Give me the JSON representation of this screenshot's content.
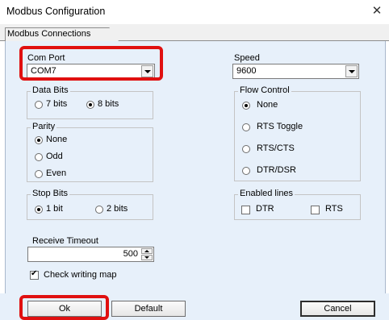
{
  "window": {
    "title": "Modbus Configuration",
    "close_glyph": "✕"
  },
  "tab": {
    "label": "Modbus Connections"
  },
  "com_port": {
    "label": "Com Port",
    "value": "COM7"
  },
  "speed": {
    "label": "Speed",
    "value": "9600"
  },
  "data_bits": {
    "title": "Data Bits",
    "options": [
      "7 bits",
      "8 bits"
    ],
    "selected": "8 bits"
  },
  "parity": {
    "title": "Parity",
    "options": [
      "None",
      "Odd",
      "Even"
    ],
    "selected": "None"
  },
  "stop_bits": {
    "title": "Stop Bits",
    "options": [
      "1 bit",
      "2 bits"
    ],
    "selected": "1 bit"
  },
  "flow_control": {
    "title": "Flow Control",
    "options": [
      "None",
      "RTS Toggle",
      "RTS/CTS",
      "DTR/DSR"
    ],
    "selected": "None"
  },
  "enabled_lines": {
    "title": "Enabled lines",
    "dtr_label": "DTR",
    "rts_label": "RTS",
    "dtr_checked": false,
    "rts_checked": false
  },
  "receive_timeout": {
    "label": "Receive Timeout",
    "value": "500"
  },
  "check_writing_map": {
    "label": "Check writing map",
    "checked": true
  },
  "buttons": {
    "ok": "Ok",
    "default": "Default",
    "cancel": "Cancel"
  },
  "colors": {
    "panel_bg": "#e7f0fa",
    "highlight": "#e01010"
  }
}
